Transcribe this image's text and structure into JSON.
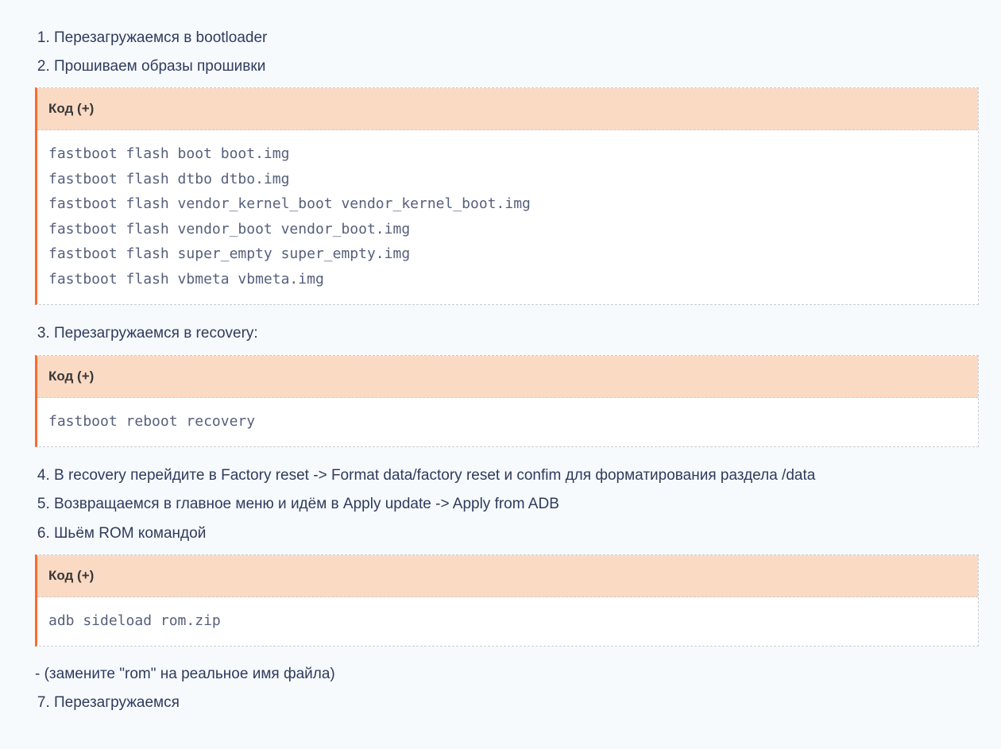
{
  "steps": {
    "s1": "Перезагружаемся в bootloader",
    "s2": "Прошиваем образы прошивки",
    "s3": "Перезагружаемся в recovery:",
    "s4": "В recovery перейдите в Factory reset -> Format data/factory reset и confim для форматирования раздела /data",
    "s5": "Возвращаемся в главное меню и идём в Apply update -> Apply from ADB",
    "s6": "Шьём ROM командой",
    "s6_note": "- (замените \"rom\" на реальное имя файла)",
    "s7": "Перезагружаемся"
  },
  "code": {
    "header_label": "Код (+)",
    "block1": "fastboot flash boot boot.img\nfastboot flash dtbo dtbo.img\nfastboot flash vendor_kernel_boot vendor_kernel_boot.img\nfastboot flash vendor_boot vendor_boot.img\nfastboot flash super_empty super_empty.img\nfastboot flash vbmeta vbmeta.img",
    "block2": "fastboot reboot recovery",
    "block3": "adb sideload rom.zip"
  }
}
